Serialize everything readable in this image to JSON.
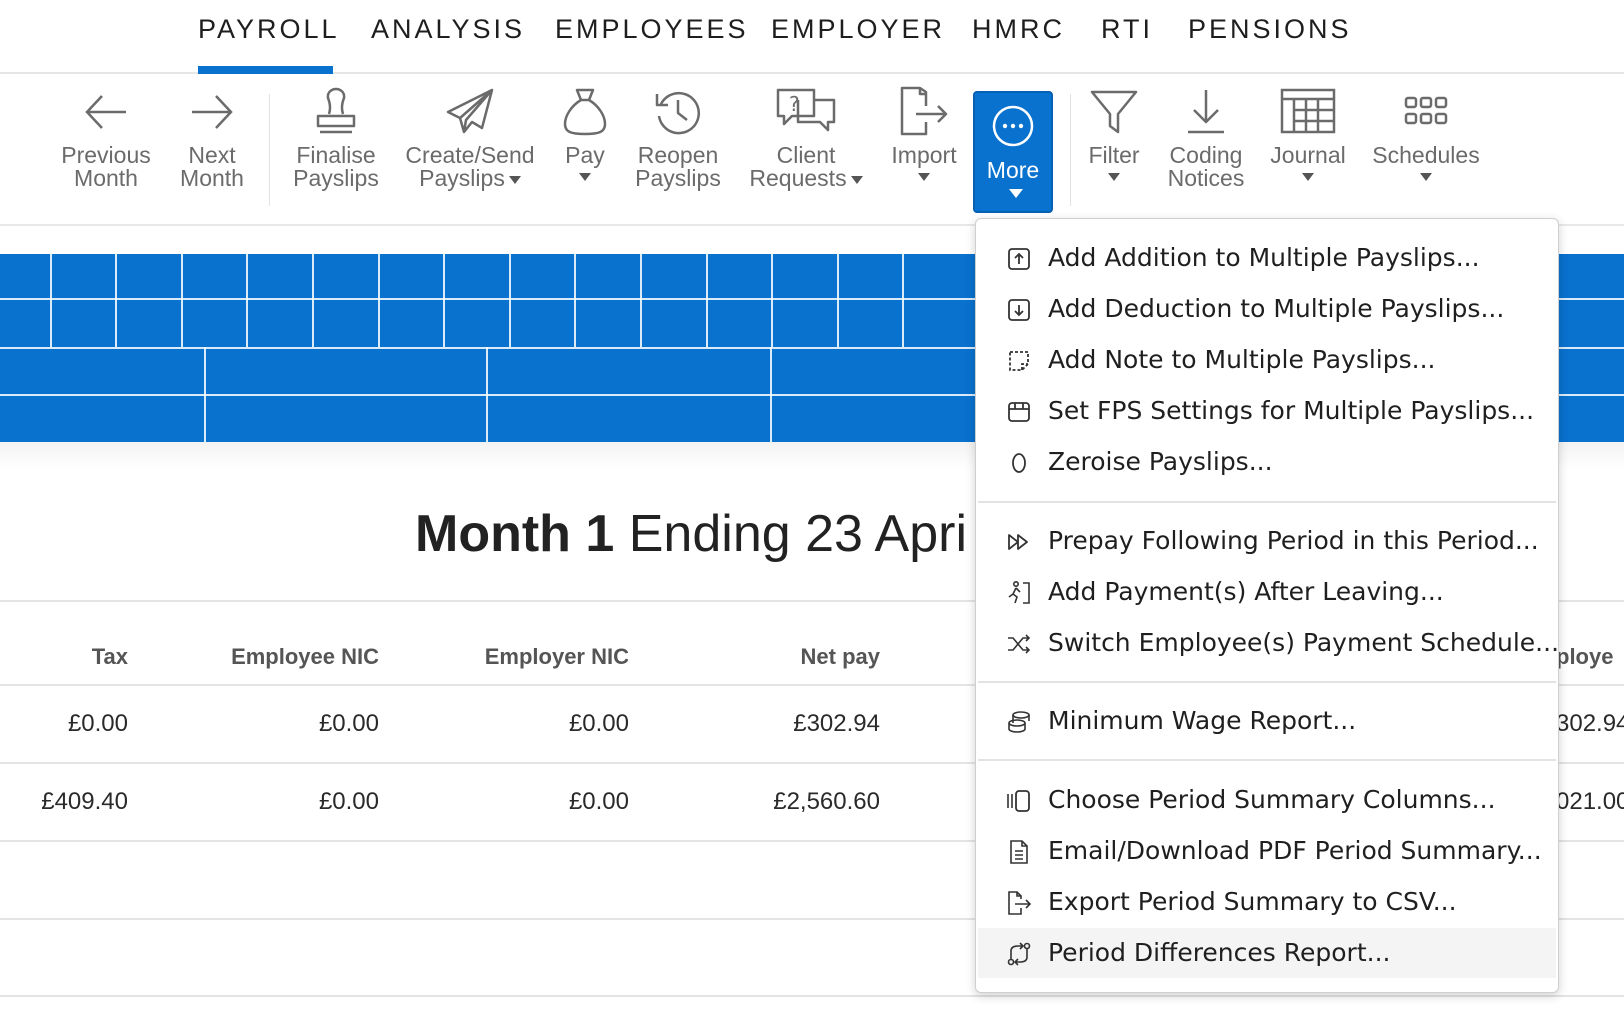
{
  "nav": {
    "tabs": [
      "PAYROLL",
      "ANALYSIS",
      "EMPLOYEES",
      "EMPLOYER",
      "HMRC",
      "RTI",
      "PENSIONS"
    ],
    "active": "PAYROLL",
    "accent": "#0971ce"
  },
  "toolbar": {
    "previous_month": [
      "Previous",
      "Month"
    ],
    "next_month": [
      "Next",
      "Month"
    ],
    "finalise": [
      "Finalise",
      "Payslips"
    ],
    "create_send": [
      "Create/Send",
      "Payslips"
    ],
    "pay": "Pay",
    "reopen": [
      "Reopen",
      "Payslips"
    ],
    "client_requests": [
      "Client",
      "Requests"
    ],
    "import": "Import",
    "more": "More",
    "filter": "Filter",
    "coding_notices": [
      "Coding",
      "Notices"
    ],
    "journal": "Journal",
    "schedules": "Schedules"
  },
  "heading": {
    "bold": "Month 1",
    "rest": " Ending 23 Apri"
  },
  "table": {
    "headers": [
      "Tax",
      "Employee NIC",
      "Employer NIC",
      "Net pay",
      "ploye"
    ],
    "rows": [
      [
        "£0.00",
        "£0.00",
        "£0.00",
        "£302.94",
        "302.94"
      ],
      [
        "£409.40",
        "£0.00",
        "£0.00",
        "£2,560.60",
        "021.00"
      ]
    ]
  },
  "menu": {
    "groups": [
      [
        {
          "icon": "upload-box-icon",
          "label": "Add Addition to Multiple Payslips..."
        },
        {
          "icon": "download-box-icon",
          "label": "Add Deduction to Multiple Payslips..."
        },
        {
          "icon": "note-icon",
          "label": "Add Note to Multiple Payslips..."
        },
        {
          "icon": "settings-box-icon",
          "label": "Set FPS Settings for Multiple Payslips..."
        },
        {
          "icon": "zero-icon",
          "label": "Zeroise Payslips..."
        }
      ],
      [
        {
          "icon": "fast-forward-icon",
          "label": "Prepay Following Period in this Period..."
        },
        {
          "icon": "leaving-person-icon",
          "label": "Add Payment(s) After Leaving..."
        },
        {
          "icon": "shuffle-icon",
          "label": "Switch Employee(s) Payment Schedule..."
        }
      ],
      [
        {
          "icon": "coins-icon",
          "label": "Minimum Wage Report..."
        }
      ],
      [
        {
          "icon": "columns-icon",
          "label": "Choose Period Summary Columns..."
        },
        {
          "icon": "document-icon",
          "label": "Email/Download PDF Period Summary..."
        },
        {
          "icon": "export-icon",
          "label": "Export Period Summary to CSV..."
        },
        {
          "icon": "differences-icon",
          "label": "Period Differences Report..."
        }
      ]
    ]
  }
}
